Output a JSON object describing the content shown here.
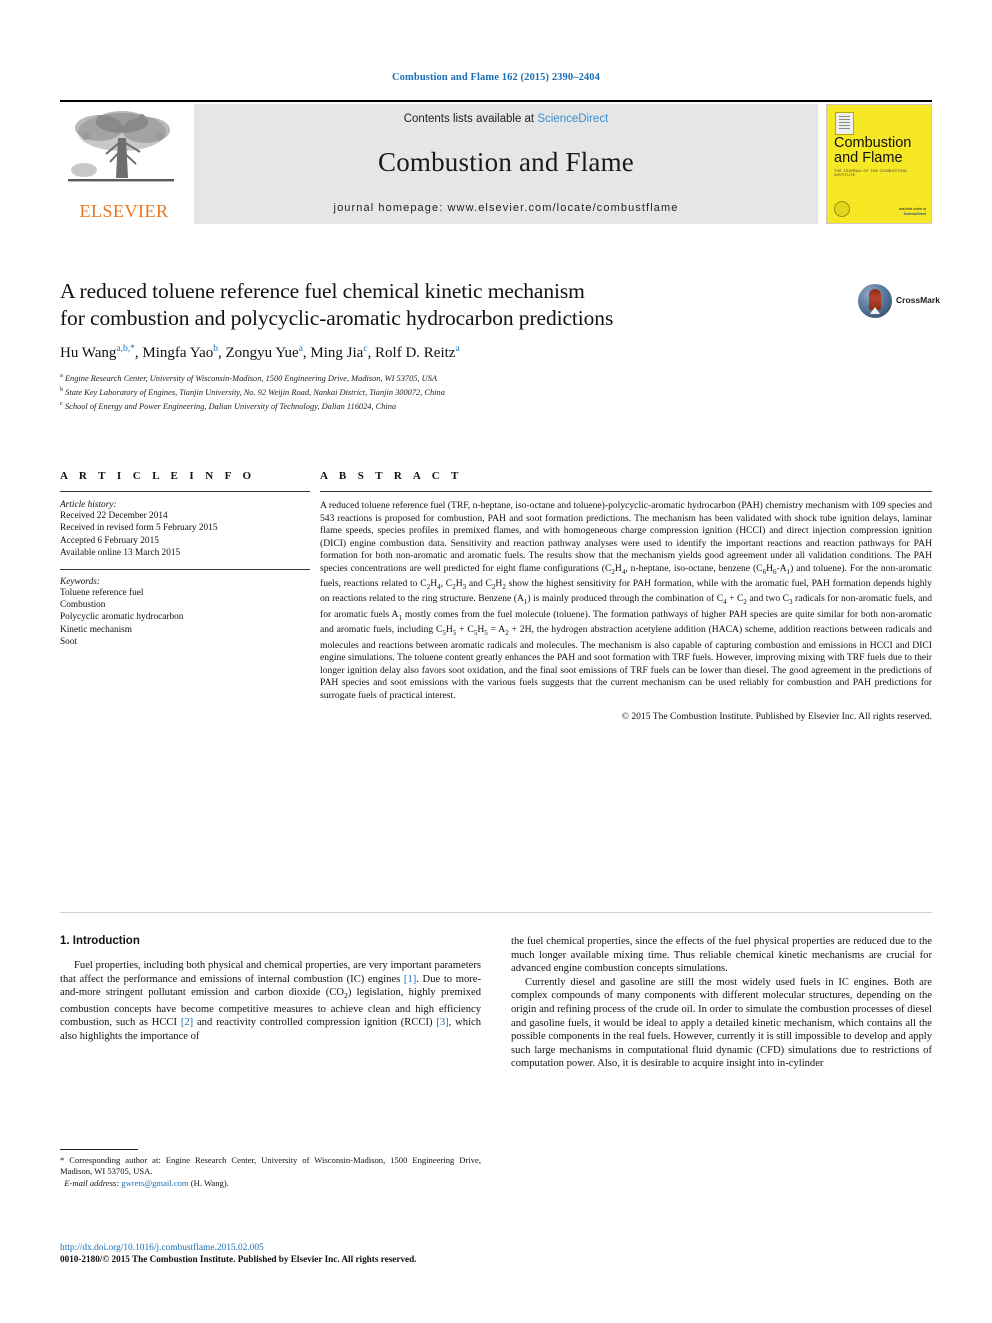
{
  "running_head": "Combustion and Flame 162 (2015) 2390–2404",
  "masthead": {
    "publisher": "ELSEVIER",
    "contents_prefix": "Contents lists available at ",
    "contents_link": "ScienceDirect",
    "journal_name": "Combustion and Flame",
    "homepage": "journal homepage: www.elsevier.com/locate/combustflame",
    "cover": {
      "title_line1": "Combustion",
      "title_line2": "and Flame",
      "subtitle": "THE JOURNAL OF THE COMBUSTION INSTITUTE",
      "footer_line1": "available online at",
      "footer_line2": "ScienceDirect"
    }
  },
  "crossmark": {
    "label": "CrossMark"
  },
  "article": {
    "title_line1": "A reduced toluene reference fuel chemical kinetic mechanism",
    "title_line2": "for combustion and polycyclic-aromatic hydrocarbon predictions",
    "authors": [
      {
        "name": "Hu Wang",
        "marks": "a,b,*"
      },
      {
        "name": "Mingfa Yao",
        "marks": "b"
      },
      {
        "name": "Zongyu Yue",
        "marks": "a"
      },
      {
        "name": "Ming Jia",
        "marks": "c"
      },
      {
        "name": "Rolf D. Reitz",
        "marks": "a"
      }
    ],
    "affiliations": [
      {
        "mark": "a",
        "text": "Engine Research Center, University of Wisconsin-Madison, 1500 Engineering Drive, Madison, WI 53705, USA"
      },
      {
        "mark": "b",
        "text": "State Key Laboratory of Engines, Tianjin University, No. 92 Weijin Road, Nankai District, Tianjin 300072, China"
      },
      {
        "mark": "c",
        "text": "School of Energy and Power Engineering, Dalian University of Technology, Dalian 116024, China"
      }
    ]
  },
  "article_info": {
    "heading": "A R T I C L E   I N F O",
    "history_label": "Article history:",
    "history": [
      "Received 22 December 2014",
      "Received in revised form 5 February 2015",
      "Accepted 6 February 2015",
      "Available online 13 March 2015"
    ],
    "keywords_label": "Keywords:",
    "keywords": [
      "Toluene reference fuel",
      "Combustion",
      "Polycyclic aromatic hydrocarbon",
      "Kinetic mechanism",
      "Soot"
    ]
  },
  "abstract": {
    "heading": "A B S T R A C T",
    "paragraphs": [
      "A reduced toluene reference fuel (TRF, n-heptane, iso-octane and toluene)-polycyclic-aromatic hydrocarbon (PAH) chemistry mechanism with 109 species and 543 reactions is proposed for combustion, PAH and soot formation predictions. The mechanism has been validated with shock tube ignition delays, laminar flame speeds, species profiles in premixed flames, and with homogeneous charge compression ignition (HCCI) and direct injection compression ignition (DICI) engine combustion data. Sensitivity and reaction pathway analyses were used to identify the important reactions and reaction pathways for PAH formation for both non-aromatic and aromatic fuels. The results show that the mechanism yields good agreement under all validation conditions. The PAH species concentrations are well predicted for eight flame configurations (C2H4, n-heptane, iso-octane, benzene (C6H6-A1) and toluene). For the non-aromatic fuels, reactions related to C2H4, C2H3 and C2H2 show the highest sensitivity for PAH formation, while with the aromatic fuel, PAH formation depends highly on reactions related to the ring structure. Benzene (A1) is mainly produced through the combination of C4 + C2 and two C3 radicals for non-aromatic fuels, and for aromatic fuels A1 mostly comes from the fuel molecule (toluene). The formation pathways of higher PAH species are quite similar for both non-aromatic and aromatic fuels, including C5H5 + C5H5 = A2 + 2H, the hydrogen abstraction acetylene addition (HACA) scheme, addition reactions between radicals and molecules and reactions between aromatic radicals and molecules. The mechanism is also capable of capturing combustion and emissions in HCCI and DICI engine simulations. The toluene content greatly enhances the PAH and soot formation with TRF fuels. However, improving mixing with TRF fuels due to their longer ignition delay also favors soot oxidation, and the final soot emissions of TRF fuels can be lower than diesel. The good agreement in the predictions of PAH species and soot emissions with the various fuels suggests that the current mechanism can be used reliably for combustion and PAH predictions for surrogate fuels of practical interest."
    ],
    "copyright": "© 2015 The Combustion Institute. Published by Elsevier Inc. All rights reserved."
  },
  "introduction": {
    "heading": "1. Introduction",
    "left_paragraphs": [
      "Fuel properties, including both physical and chemical properties, are very important parameters that affect the performance and emissions of internal combustion (IC) engines [1]. Due to more-and-more stringent pollutant emission and carbon dioxide (CO2) legislation, highly premixed combustion concepts have become competitive measures to achieve clean and high efficiency combustion, such as HCCI [2] and reactivity controlled compression ignition (RCCI) [3], which also highlights the importance of"
    ],
    "right_paragraphs": [
      "the fuel chemical properties, since the effects of the fuel physical properties are reduced due to the much longer available mixing time. Thus reliable chemical kinetic mechanisms are crucial for advanced engine combustion concepts simulations.",
      "Currently diesel and gasoline are still the most widely used fuels in IC engines. Both are complex compounds of many components with different molecular structures, depending on the origin and refining process of the crude oil. In order to simulate the combustion processes of diesel and gasoline fuels, it would be ideal to apply a detailed kinetic mechanism, which contains all the possible components in the real fuels. However, currently it is still impossible to develop and apply such large mechanisms in computational fluid dynamic (CFD) simulations due to restrictions of computation power. Also, it is desirable to acquire insight into in-cylinder"
    ]
  },
  "footnote": {
    "corresponding": "* Corresponding author at: Engine Research Center, University of Wisconsin-Madison, 1500 Engineering Drive, Madison, WI 53705, USA.",
    "email_label": "E-mail address:",
    "email": "gwrets@gmail.com",
    "email_suffix": "(H. Wang)."
  },
  "bottom": {
    "doi": "http://dx.doi.org/10.1016/j.combustflame.2015.02.005",
    "issn": "0010-2180/© 2015 The Combustion Institute. Published by Elsevier Inc. All rights reserved."
  },
  "colors": {
    "link": "#1a6fb5",
    "elsevier_orange": "#E87722",
    "cover_yellow": "#f7e825",
    "masthead_grey": "#e6e6e6"
  }
}
